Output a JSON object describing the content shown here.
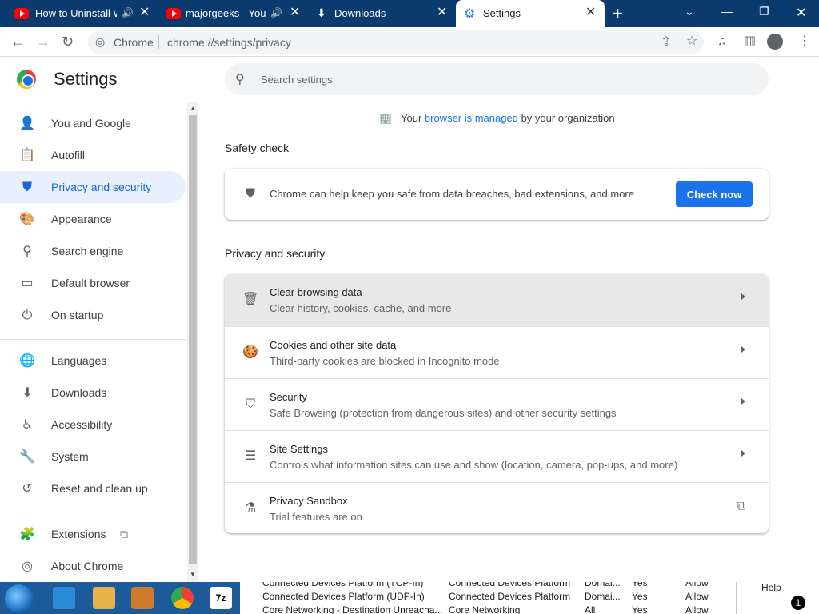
{
  "tabs": [
    {
      "title": "How to Uninstall W",
      "icon": "youtube-icon"
    },
    {
      "title": "majorgeeks - YouT",
      "icon": "youtube-icon"
    },
    {
      "title": "Downloads",
      "icon": "download-icon"
    },
    {
      "title": "Settings",
      "icon": "gear-icon"
    }
  ],
  "toolbar": {
    "site_name": "Chrome",
    "url": "chrome://settings/privacy"
  },
  "sidebar": {
    "title": "Settings",
    "items": [
      {
        "label": "You and Google",
        "icon": "person-icon"
      },
      {
        "label": "Autofill",
        "icon": "clipboard-icon"
      },
      {
        "label": "Privacy and security",
        "icon": "shield-icon"
      },
      {
        "label": "Appearance",
        "icon": "palette-icon"
      },
      {
        "label": "Search engine",
        "icon": "search-icon"
      },
      {
        "label": "Default browser",
        "icon": "browser-icon"
      },
      {
        "label": "On startup",
        "icon": "power-icon"
      },
      {
        "label": "Languages",
        "icon": "globe-icon"
      },
      {
        "label": "Downloads",
        "icon": "download-icon"
      },
      {
        "label": "Accessibility",
        "icon": "accessibility-icon"
      },
      {
        "label": "System",
        "icon": "wrench-icon"
      },
      {
        "label": "Reset and clean up",
        "icon": "restore-icon"
      },
      {
        "label": "Extensions",
        "icon": "puzzle-icon"
      },
      {
        "label": "About Chrome",
        "icon": "chrome-icon"
      }
    ]
  },
  "search": {
    "placeholder": "Search settings"
  },
  "managed": {
    "prefix": "Your ",
    "link": "browser is managed",
    "suffix": " by your organization"
  },
  "safety_check": {
    "heading": "Safety check",
    "text": "Chrome can help keep you safe from data breaches, bad extensions, and more",
    "button": "Check now"
  },
  "privacy": {
    "heading": "Privacy and security",
    "rows": [
      {
        "title": "Clear browsing data",
        "subtitle": "Clear history, cookies, cache, and more",
        "icon": "trash-icon"
      },
      {
        "title": "Cookies and other site data",
        "subtitle": "Third-party cookies are blocked in Incognito mode",
        "icon": "cookie-icon"
      },
      {
        "title": "Security",
        "subtitle": "Safe Browsing (protection from dangerous sites) and other security settings",
        "icon": "shield-icon"
      },
      {
        "title": "Site Settings",
        "subtitle": "Controls what information sites can use and show (location, camera, pop-ups, and more)",
        "icon": "sliders-icon"
      },
      {
        "title": "Privacy Sandbox",
        "subtitle": "Trial features are on",
        "icon": "flask-icon"
      }
    ]
  },
  "taskbar_behind": {
    "col1": [
      "Connected Devices Platform (TCP-In)",
      "Connected Devices Platform (UDP-In)",
      "Core Networking - Destination Unreacha..."
    ],
    "col2": [
      "Connected Devices Platform",
      "Connected Devices Platform",
      "Core Networking"
    ],
    "col3": [
      "Domai...",
      "Domai...",
      "All"
    ],
    "col4": [
      "Yes",
      "Yes",
      "Yes"
    ],
    "col5": [
      "Allow",
      "Allow",
      "Allow"
    ],
    "help": "Help",
    "badge": "1"
  },
  "colors": {
    "accent": "#1a73e8",
    "titlebar": "#0b3b6e"
  }
}
